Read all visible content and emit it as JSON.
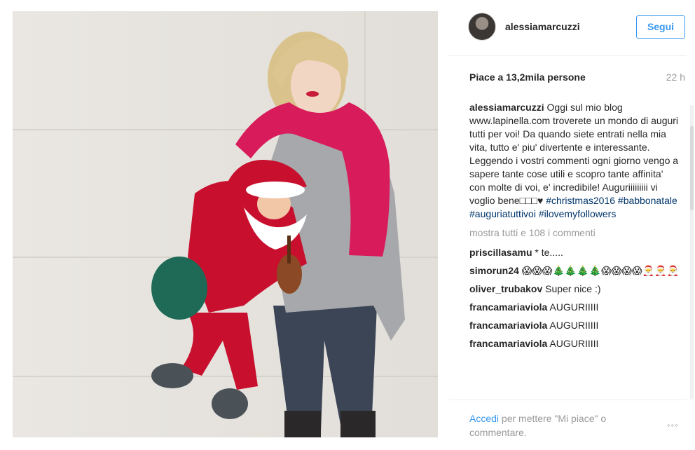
{
  "post": {
    "username": "alessiamarcuzzi",
    "follow_label": "Segui",
    "likes_text": "Piace a 13,2mila persone",
    "time_ago": "22 h",
    "caption": {
      "text": "Oggi sul mio blog www.lapinella.com troverete un mondo di auguri tutti per voi! Da quando siete entrati nella mia vita, tutto e' piu' divertente e interessante. Leggendo i vostri commenti ogni giorno vengo a sapere tante cose utili e scopro tante affinita' con molte di voi, e' incredibile! Auguriiiiiiiii vi voglio bene□□□♥",
      "hashtags": [
        "#christmas2016",
        "#babbonatale",
        "#auguriatuttivoi",
        "#ilovemyfollowers"
      ]
    },
    "show_all_comments": "mostra tutti e 108 i commenti",
    "comments": [
      {
        "user": "priscillasamu",
        "text": "* te....."
      },
      {
        "user": "simorun24",
        "text": "😱😱😱🎄🎄🎄🎄😱😱😱😱🎅🎅🎅"
      },
      {
        "user": "oliver_trubakov",
        "text": "Super nice :)"
      },
      {
        "user": "francamariaviola",
        "text": "AUGURIIIII"
      },
      {
        "user": "francamariaviola",
        "text": "AUGURIIIII"
      },
      {
        "user": "francamariaviola",
        "text": "AUGURIIIII"
      }
    ],
    "footer": {
      "login_link": "Accedi",
      "login_rest": "per mettere \"Mi piace\" o commentare.",
      "more_icon": "ellipsis-icon",
      "more_glyph": "◦◦◦"
    }
  },
  "colors": {
    "accent": "#3897f0",
    "hashtag": "#003569",
    "muted": "#999999",
    "scarf": "#d81b5a",
    "santa_red": "#c8102e"
  }
}
